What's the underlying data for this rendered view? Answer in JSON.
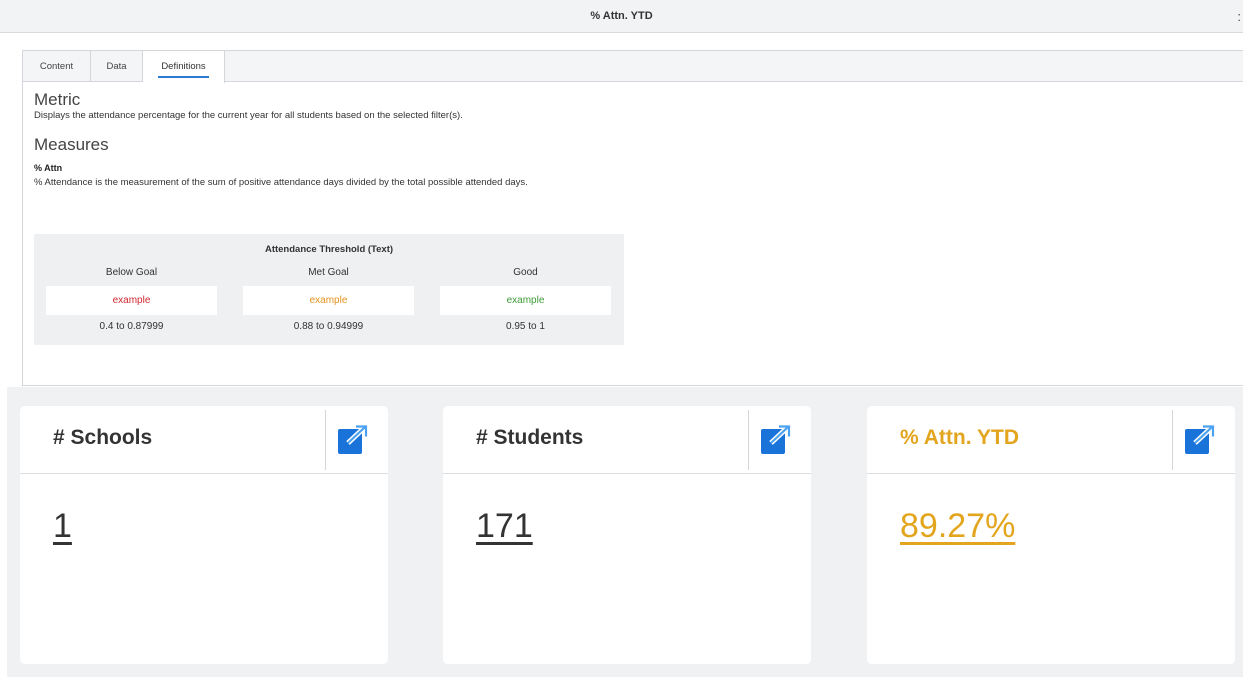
{
  "header": {
    "title": "% Attn. YTD",
    "more": ":"
  },
  "tabs": [
    {
      "label": "Content"
    },
    {
      "label": "Data"
    },
    {
      "label": "Definitions"
    }
  ],
  "definitions": {
    "metric_heading": "Metric",
    "metric_text": "Displays the attendance percentage for the current year for all students based on the selected filter(s).",
    "measures_heading": "Measures",
    "measure_name": "% Attn",
    "measure_text": "% Attendance is the measurement of the sum of positive attendance days divided by the total possible attended days.",
    "threshold": {
      "title": "Attendance Threshold (Text)",
      "columns": [
        {
          "label": "Below Goal",
          "example": "example",
          "range": "0.4 to 0.87999",
          "color": "#d0282e"
        },
        {
          "label": "Met Goal",
          "example": "example",
          "range": "0.88 to 0.94999",
          "color": "#e3921d"
        },
        {
          "label": "Good",
          "example": "example",
          "range": "0.95 to 1",
          "color": "#3e9a3a"
        }
      ]
    }
  },
  "cards": [
    {
      "title": "# Schools",
      "value": "1",
      "icon": "open-external-icon"
    },
    {
      "title": "# Students",
      "value": "171",
      "icon": "open-external-icon"
    },
    {
      "title": "% Attn. YTD",
      "value": "89.27%",
      "icon": "open-external-icon",
      "accent": "#e3a51d"
    }
  ],
  "colors": {
    "accent_blue": "#1a73d9",
    "tab_underline": "#2a7ad2",
    "gold": "#e3a51d"
  }
}
